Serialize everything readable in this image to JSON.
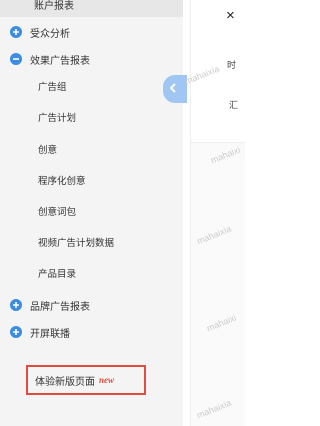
{
  "sidebar": {
    "top_item": "账户报表",
    "groups": [
      {
        "label": "受众分析",
        "state": "collapsed"
      },
      {
        "label": "效果广告报表",
        "state": "expanded"
      },
      {
        "label": "品牌广告报表",
        "state": "collapsed"
      },
      {
        "label": "开屏联播",
        "state": "collapsed"
      }
    ],
    "effect_items": [
      "广告组",
      "广告计划",
      "创意",
      "程序化创意",
      "创意词包",
      "视频广告计划数据",
      "产品目录"
    ],
    "new_page": {
      "label": "体验新版页面",
      "badge": "new"
    }
  },
  "content": {
    "close_glyph": "×",
    "label_1": "时",
    "label_2": "汇"
  },
  "watermarks": [
    "mahaixia",
    "mahaixi",
    "mahaixia",
    "mahaixi",
    "mahaixia"
  ],
  "colors": {
    "accent": "#3c8ce7",
    "collapse_tab": "#a0c6f4",
    "highlight_border": "#e24b3f",
    "sidebar_bg": "#f4f4f4"
  }
}
